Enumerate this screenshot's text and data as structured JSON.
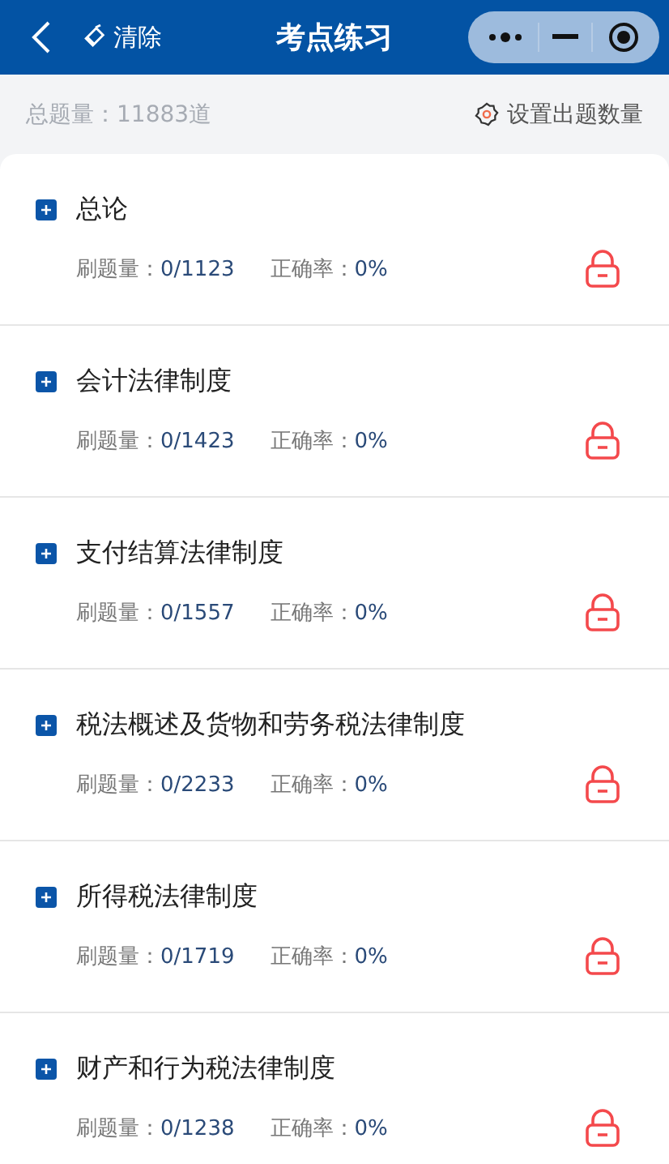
{
  "header": {
    "clear_label": "清除",
    "title": "考点练习"
  },
  "summary": {
    "total": "总题量：11883道",
    "settings_label": "设置出题数量"
  },
  "chapters": [
    {
      "title": "总论",
      "done_label": "刷题量：",
      "done": "0/1123",
      "rate_label": "正确率：",
      "rate": "0%",
      "locked": true
    },
    {
      "title": "会计法律制度",
      "done_label": "刷题量：",
      "done": "0/1423",
      "rate_label": "正确率：",
      "rate": "0%",
      "locked": true
    },
    {
      "title": "支付结算法律制度",
      "done_label": "刷题量：",
      "done": "0/1557",
      "rate_label": "正确率：",
      "rate": "0%",
      "locked": true
    },
    {
      "title": "税法概述及货物和劳务税法律制度",
      "done_label": "刷题量：",
      "done": "0/2233",
      "rate_label": "正确率：",
      "rate": "0%",
      "locked": true
    },
    {
      "title": "所得税法律制度",
      "done_label": "刷题量：",
      "done": "0/1719",
      "rate_label": "正确率：",
      "rate": "0%",
      "locked": true
    },
    {
      "title": "财产和行为税法律制度",
      "done_label": "刷题量：",
      "done": "0/1238",
      "rate_label": "正确率：",
      "rate": "0%",
      "locked": true
    }
  ]
}
